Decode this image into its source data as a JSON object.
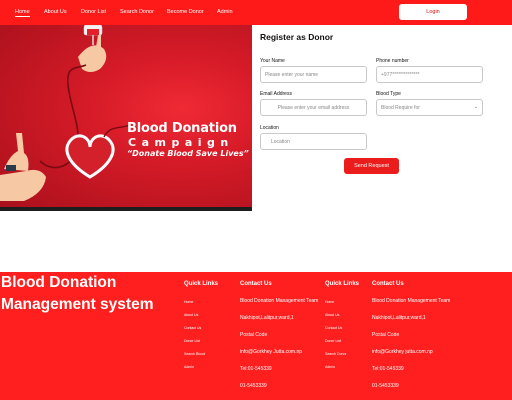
{
  "nav": {
    "links": [
      "Home",
      "About Us",
      "Donor List",
      "Search Donor",
      "Become Donor",
      "Admin"
    ],
    "login_label": "Login"
  },
  "banner": {
    "title": "Blood Donation",
    "subtitle": "Campaign",
    "slogan": "“Donate Blood Save Lives”"
  },
  "form": {
    "title": "Register as Donor",
    "name_label": "Your Name",
    "name_placeholder": "Please enter your name",
    "phone_label": "Phone number",
    "phone_placeholder": "+977**************",
    "email_label": "Email Address",
    "email_placeholder": "Please enter your email address",
    "blood_label": "Blood Type",
    "blood_placeholder": "Blood Require for",
    "location_label": "Location",
    "location_placeholder": "Location",
    "submit_label": "Send Request"
  },
  "footer": {
    "brand": "Blood Donation Management system",
    "quick_links_title": "Quick Links",
    "quick_links": [
      "Home",
      "About Us",
      "Contact Us",
      "Donor List",
      "Search Blood",
      "Admin"
    ],
    "contact_title": "Contact Us",
    "contact_lines": [
      "Blood Donation Management Team",
      "Nakhipot,Lalitpur,ward,1",
      "Postal Code",
      "info@Gorkhey Jutta.com.np",
      "Tel:01-545339",
      "01-5453339"
    ],
    "quick_links_title_2": "Quick Links",
    "quick_links_2": [
      "Home",
      "About Us",
      "Contact Us",
      "Donor List",
      "Search Donor",
      "Admin"
    ],
    "contact_title_2": "Contact Us",
    "contact_lines_2": [
      "Blood Donation Management Team",
      "Nakhipot,Lalitpur,ward,1",
      "Postal Code",
      "info@Gorkhey jutta.com.np",
      "Tel:01-545339",
      "01-5453339"
    ]
  },
  "colors": {
    "brand_red": "#ff1a1a",
    "button_red": "#ea1c1c"
  }
}
